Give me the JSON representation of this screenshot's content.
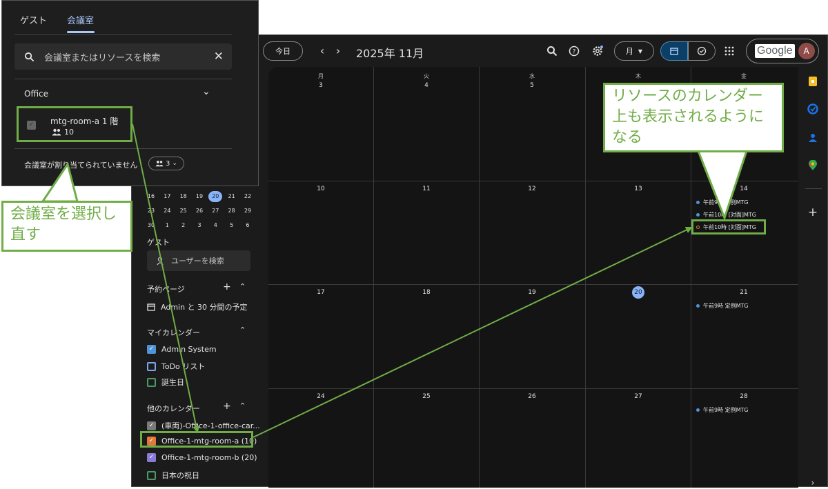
{
  "header": {
    "today_label": "今日",
    "prev_icon": "chevron-left-icon",
    "next_icon": "chevron-right-icon",
    "month_title": "2025年 11月",
    "view_label": "月",
    "account_brand": "Google",
    "avatar_initial": "A"
  },
  "mini_calendar": {
    "rows": [
      [
        "16",
        "17",
        "18",
        "19",
        "20",
        "21",
        "22"
      ],
      [
        "23",
        "24",
        "25",
        "26",
        "27",
        "28",
        "29"
      ],
      [
        "30",
        "1",
        "2",
        "3",
        "4",
        "5",
        "6"
      ]
    ],
    "selected": "20"
  },
  "sidebar": {
    "guest_heading": "ゲスト",
    "user_search_placeholder": "ユーザーを検索",
    "booking_heading": "予約ページ",
    "booking_item": "Admin と 30 分間の予定",
    "my_calendars_heading": "マイカレンダー",
    "my_calendars": [
      {
        "label": "Admin System",
        "color": "#4e94d6",
        "checked": true
      },
      {
        "label": "ToDo リスト",
        "color": "#7aa7e8",
        "checked": false
      },
      {
        "label": "誕生日",
        "color": "#4a9a68",
        "checked": false
      }
    ],
    "other_calendars_heading": "他のカレンダー",
    "other_calendars": [
      {
        "label": "(車両)-Office-1-office-car...",
        "color": "#7a7a7a",
        "checked": true
      },
      {
        "label": "Office-1-mtg-room-a (10)",
        "color": "#e07a3a",
        "checked": true
      },
      {
        "label": "Office-1-mtg-room-b (20)",
        "color": "#8a7ad6",
        "checked": true
      },
      {
        "label": "日本の祝日",
        "color": "#4a9a68",
        "checked": false
      }
    ]
  },
  "grid": {
    "weekdays": [
      "月",
      "火",
      "水",
      "木",
      "金"
    ],
    "weeks": [
      [
        "3",
        "4",
        "5",
        "",
        ""
      ],
      [
        "10",
        "11",
        "12",
        "13",
        "14"
      ],
      [
        "17",
        "18",
        "19",
        "20",
        "21"
      ],
      [
        "24",
        "25",
        "26",
        "27",
        "28"
      ]
    ],
    "today": "20",
    "events": {
      "fri14": [
        "午前9時 定例MTG",
        "午前10時 [対面]MTG",
        "午前10時 [対面]MTG"
      ],
      "fri21": [
        "午前9時 定例MTG"
      ],
      "fri28": [
        "午前9時 定例MTG"
      ]
    }
  },
  "popup": {
    "tab_guest": "ゲスト",
    "tab_rooms": "会議室",
    "search_placeholder": "会議室またはリソースを検索",
    "group_label": "Office",
    "room_name": "mtg-room-a  1 階",
    "room_capacity": "10",
    "unassigned_text": "会議室が割り当てられていません",
    "guest_count": "3"
  },
  "annotations": {
    "left_callout": "会議室を選択し直す",
    "right_callout": "リソースのカレンダー上も表示されるようになる",
    "color": "#70ad47"
  }
}
